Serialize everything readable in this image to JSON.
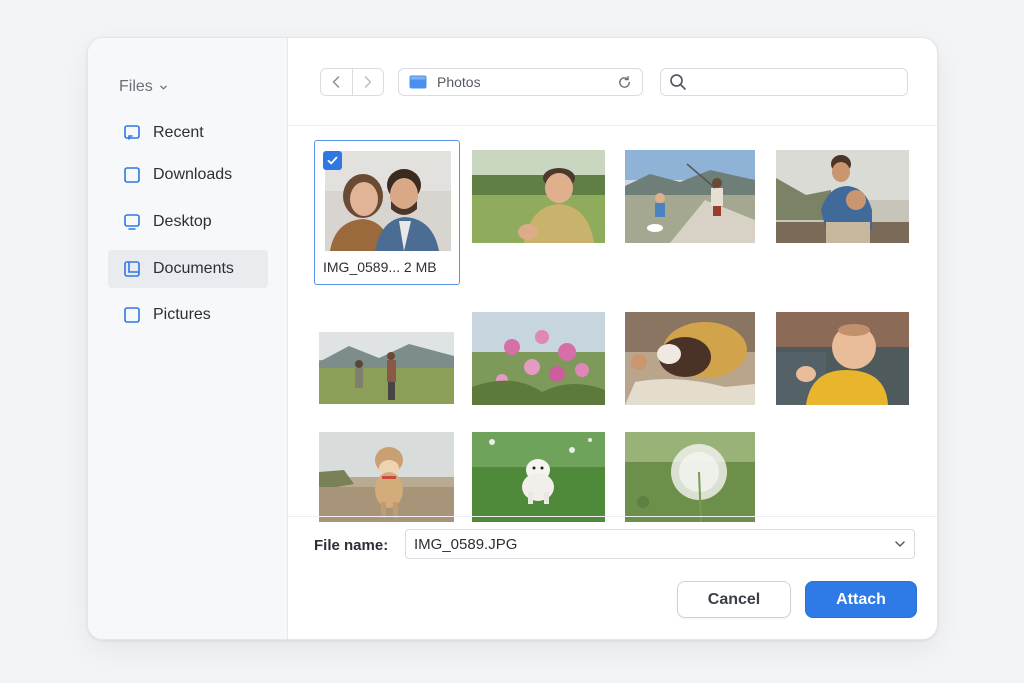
{
  "sidebar": {
    "header": "Files",
    "items": [
      {
        "label": "Recent",
        "icon": "recent-icon",
        "active": false
      },
      {
        "label": "Downloads",
        "icon": "downloads-icon",
        "active": false
      },
      {
        "label": "Desktop",
        "icon": "desktop-icon",
        "active": false
      },
      {
        "label": "Documents",
        "icon": "documents-icon",
        "active": true
      },
      {
        "label": "Pictures",
        "icon": "pictures-icon",
        "active": false
      }
    ]
  },
  "toolbar": {
    "location": "Photos",
    "search_value": "",
    "search_placeholder": ""
  },
  "files": {
    "selected_caption": "IMG_0589... 2 MB",
    "thumbnails": [
      "couple-selfie",
      "boy-in-field",
      "kids-on-beach",
      "kids-hugging",
      "hikers-trail",
      "pink-flowers",
      "dog-sleeping",
      "baby-smiling",
      "puppy-on-sand",
      "white-puppy-grass",
      "dandelion"
    ]
  },
  "footer": {
    "file_name_label": "File name:",
    "file_name_value": "IMG_0589.JPG",
    "cancel_label": "Cancel",
    "attach_label": "Attach"
  },
  "colors": {
    "accent": "#2e7ae6",
    "selection_border": "#5b95e8",
    "icon_blue": "#2f77e3"
  }
}
